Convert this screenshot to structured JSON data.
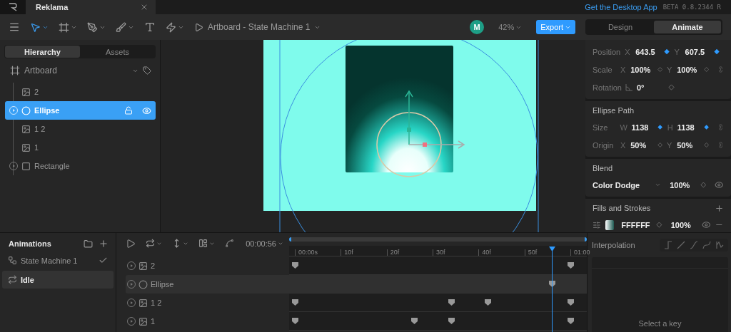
{
  "app": {
    "tab_title": "Reklama",
    "desktop_link": "Get the Desktop App",
    "version": "BETA 0.8.2344 R"
  },
  "toolbar": {
    "breadcrumb": "Artboard - State Machine 1",
    "avatar": "M",
    "zoom": "42%",
    "export": "Export",
    "modes": [
      {
        "label": "Design",
        "selected": false
      },
      {
        "label": "Animate",
        "selected": true
      }
    ]
  },
  "hierarchy": {
    "tabs": [
      {
        "label": "Hierarchy",
        "selected": true
      },
      {
        "label": "Assets",
        "selected": false
      }
    ],
    "root": {
      "name": "Artboard",
      "children": [
        {
          "name": "2",
          "kind": "image",
          "selected": false,
          "expandable": false
        },
        {
          "name": "Ellipse",
          "kind": "ellipse",
          "selected": true,
          "expandable": true
        },
        {
          "name": "1 2",
          "kind": "image",
          "selected": false,
          "expandable": false
        },
        {
          "name": "1",
          "kind": "image",
          "selected": false,
          "expandable": false
        },
        {
          "name": "Rectangle",
          "kind": "rectangle",
          "selected": false,
          "expandable": true
        }
      ]
    }
  },
  "properties": {
    "transform": [
      {
        "label": "Position",
        "kind": "pair",
        "fields": [
          {
            "axis": "X",
            "value": "643.5",
            "keyed": true
          },
          {
            "axis": "Y",
            "value": "607.5",
            "keyed": true
          }
        ]
      },
      {
        "label": "Scale",
        "kind": "pair_linked",
        "fields": [
          {
            "axis": "X",
            "value": "100%",
            "keyed": false
          },
          {
            "axis": "Y",
            "value": "100%",
            "keyed": false
          }
        ]
      },
      {
        "label": "Rotation",
        "kind": "angle",
        "fields": [
          {
            "value": "0°",
            "keyed": false
          }
        ]
      }
    ],
    "ellipse_path": {
      "title": "Ellipse Path",
      "rows": [
        {
          "label": "Size",
          "kind": "pair_linked",
          "fields": [
            {
              "axis": "W",
              "value": "1138",
              "keyed": true
            },
            {
              "axis": "H",
              "value": "1138",
              "keyed": true
            }
          ]
        },
        {
          "label": "Origin",
          "kind": "pair_linked",
          "fields": [
            {
              "axis": "X",
              "value": "50%",
              "keyed": false
            },
            {
              "axis": "Y",
              "value": "50%",
              "keyed": false
            }
          ]
        }
      ]
    },
    "blend": {
      "title": "Blend",
      "mode": "Color Dodge",
      "opacity": "100%",
      "keyed": false,
      "visible": true
    },
    "fills": {
      "title": "Fills and Strokes",
      "items": [
        {
          "hex": "FFFFFF",
          "opacity": "100%",
          "keyed": false,
          "visible": true
        }
      ]
    }
  },
  "animations": {
    "title": "Animations",
    "items": [
      {
        "name": "State Machine 1",
        "kind": "state_machine",
        "selected": false,
        "checked": true
      },
      {
        "name": "Idle",
        "kind": "loop",
        "selected": true,
        "checked": false
      }
    ]
  },
  "timeline": {
    "time": "00:00:56",
    "ticks": [
      "00:00s",
      "10f",
      "20f",
      "30f",
      "40f",
      "50f",
      "01:00"
    ],
    "playhead": {
      "level": 0.933
    },
    "rows": [
      {
        "name": "2",
        "kind": "image",
        "selected": false,
        "keys": [
          {
            "level": 0
          },
          {
            "level": 1
          }
        ]
      },
      {
        "name": "Ellipse",
        "kind": "ellipse",
        "selected": true,
        "keys": [
          {
            "level": 0.933
          }
        ]
      },
      {
        "name": "1 2",
        "kind": "image",
        "selected": false,
        "keys": [
          {
            "level": 0
          },
          {
            "level": 0.567
          },
          {
            "level": 0.7
          },
          {
            "level": 1
          }
        ]
      },
      {
        "name": "1",
        "kind": "image",
        "selected": false,
        "keys": [
          {
            "level": 0
          },
          {
            "level": 0.433
          },
          {
            "level": 0.567
          },
          {
            "level": 1
          }
        ]
      }
    ]
  },
  "interpolation": {
    "title": "Interpolation",
    "empty": "Select a key"
  }
}
